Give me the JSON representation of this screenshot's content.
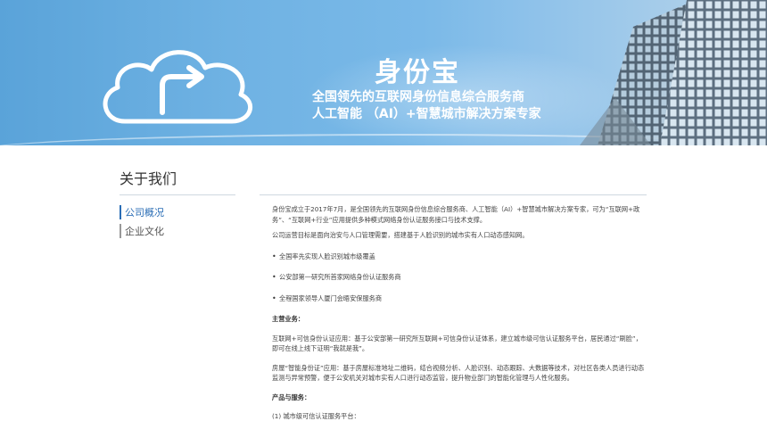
{
  "banner": {
    "brand": "身份宝",
    "tagline_1": "全国领先的互联网身份信息综合服务商",
    "tagline_2": "人工智能 （AI）+智慧城市解决方案专家"
  },
  "page": {
    "title": "关于我们"
  },
  "sidebar": {
    "items": [
      {
        "label": "公司概况"
      },
      {
        "label": "企业文化"
      }
    ]
  },
  "content": {
    "p1": "身份宝成立于2017年7月，是全国领先的互联网身份信息综合服务商、人工智能（AI）+智慧城市解决方案专家，可为“互联网+政务”、“互联网+行业”应用提供多种模式网络身份认证服务接口与技术支撑。",
    "p2": "公司运营目标是面向治安与人口管理需要，搭建基于人脸识别的城市实有人口动态感知网。",
    "bullets": [
      "全国率先实现人脸识别城市级覆盖",
      "公安部第一研究所首家网络身份认证服务商",
      "全程国家领导人厦门会晤安保服务商"
    ],
    "main_business_heading": "主营业务：",
    "p3": "互联网+可信身份认证应用：基于公安部第一研究所互联网+可信身份认证体系，建立城市级可信认证服务平台，居民通过“刷脸”，即可在线上线下证明“我就是我”。",
    "p4": "房屋“智能身份证”应用：基于房屋标准地址二维码，结合视频分析、人脸识别、动态跟踪、大数据等技术，对社区各类人员进行动态监测与异常预警，便于公安机关对城市实有人口进行动态监管，提升物业部门的智能化管理与人性化服务。",
    "products_heading": "产品与服务：",
    "p5": "(1) 城市级可信认证服务平台："
  }
}
